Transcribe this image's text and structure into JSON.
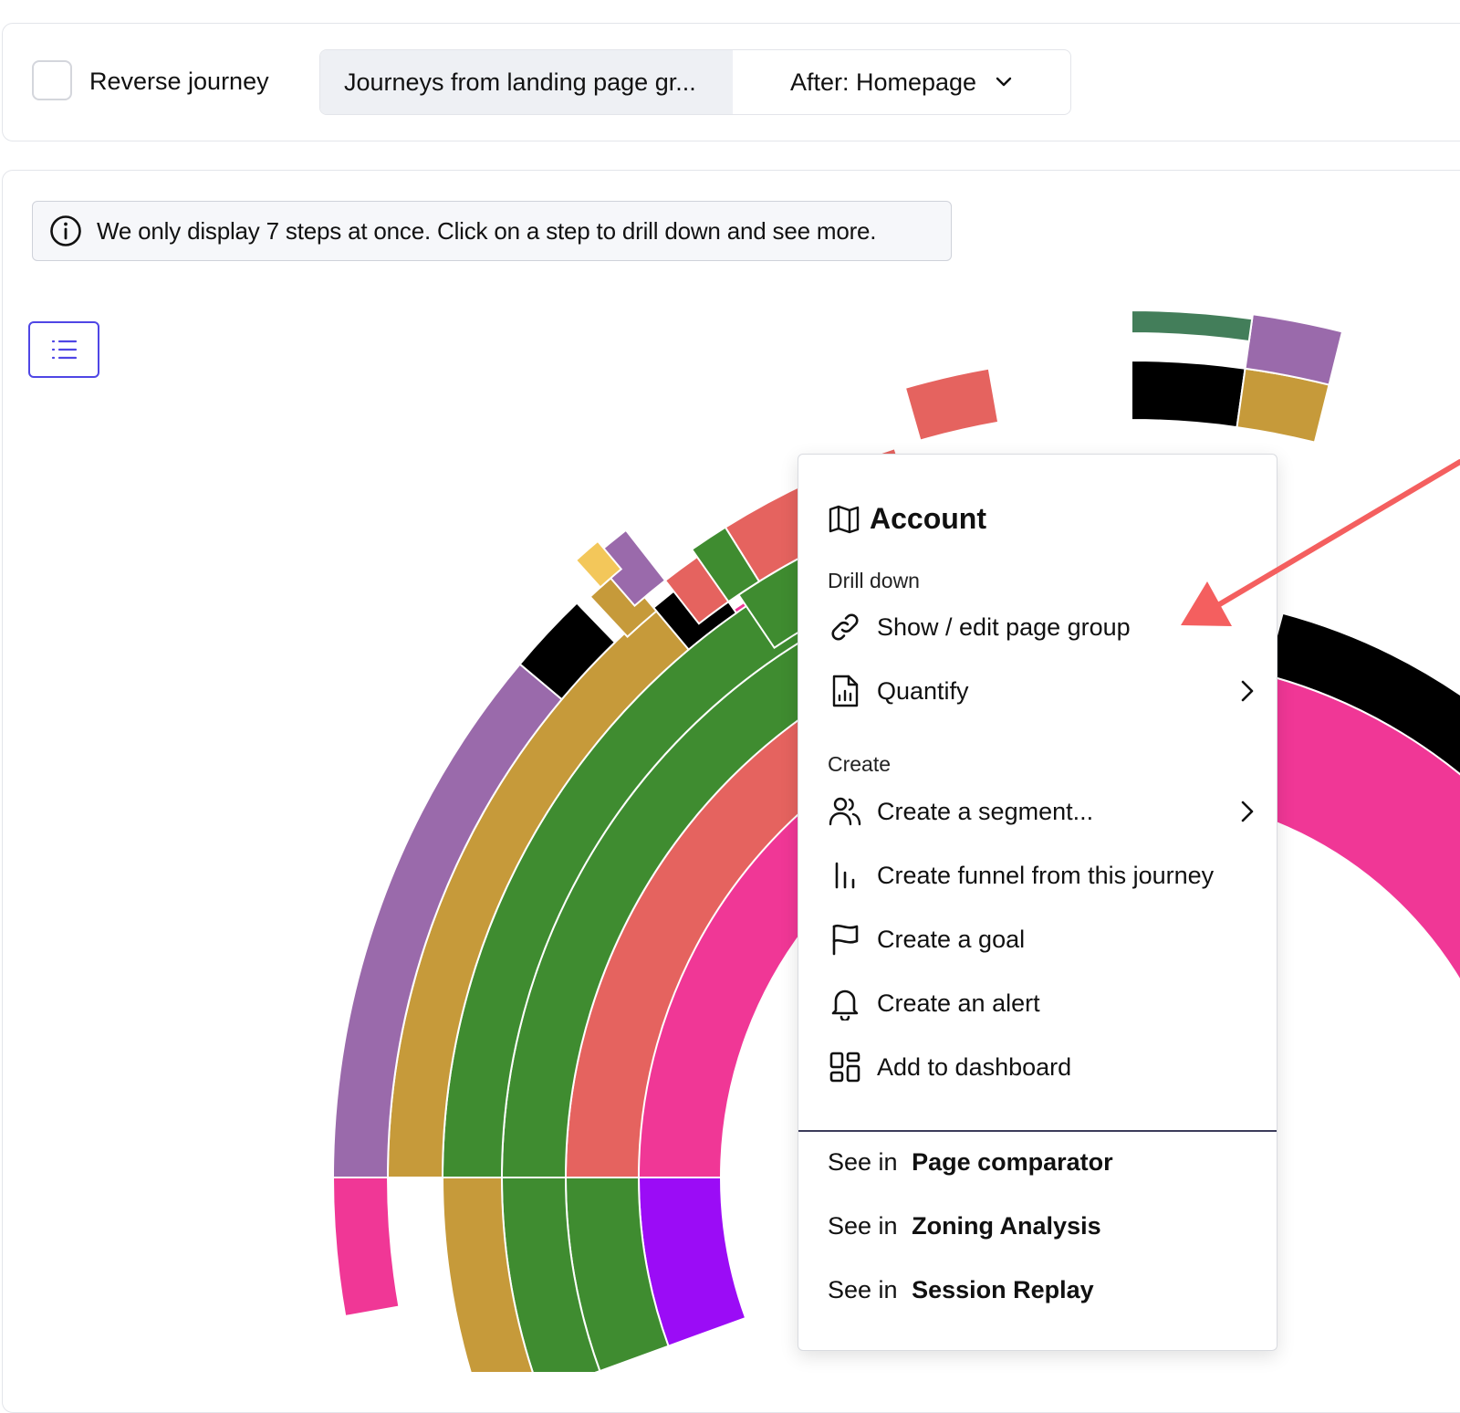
{
  "toolbar": {
    "reverse_journey_label": "Reverse journey",
    "reverse_journey_checked": false,
    "segment_active_label": "Journeys from landing page gr...",
    "segment_dropdown_label": "After: Homepage"
  },
  "info_banner": {
    "text": "We only display 7 steps at once. Click on a step to drill down and see more."
  },
  "colors": {
    "accent": "#4f46e5",
    "pink": "#f03796",
    "red": "#e5635f",
    "green": "#3f8c30",
    "purple_violet": "#9b0cf6",
    "gold": "#c69a3a",
    "lavender": "#9a6aab",
    "black": "#000000",
    "teal_green": "#437e5a",
    "yellow": "#f3c75a",
    "arrow": "#f45f5f"
  },
  "context_menu": {
    "title": "Account",
    "title_icon": "map-icon",
    "drill_down_header": "Drill down",
    "drill_down_items": [
      {
        "label": "Show / edit page group",
        "icon": "link-icon",
        "has_submenu": false
      },
      {
        "label": "Quantify",
        "icon": "chart-file-icon",
        "has_submenu": true
      }
    ],
    "create_header": "Create",
    "create_items": [
      {
        "label": "Create a segment...",
        "icon": "users-icon",
        "has_submenu": true
      },
      {
        "label": "Create funnel from this journey",
        "icon": "funnel-bars-icon",
        "has_submenu": false
      },
      {
        "label": "Create a goal",
        "icon": "flag-icon",
        "has_submenu": false
      },
      {
        "label": "Create an alert",
        "icon": "bell-icon",
        "has_submenu": false
      },
      {
        "label": "Add to dashboard",
        "icon": "dashboard-icon",
        "has_submenu": false
      }
    ],
    "see_in_prefix": "See in",
    "see_in_items": [
      {
        "target": "Page comparator"
      },
      {
        "target": "Zoning Analysis"
      },
      {
        "target": "Session Replay"
      }
    ]
  }
}
